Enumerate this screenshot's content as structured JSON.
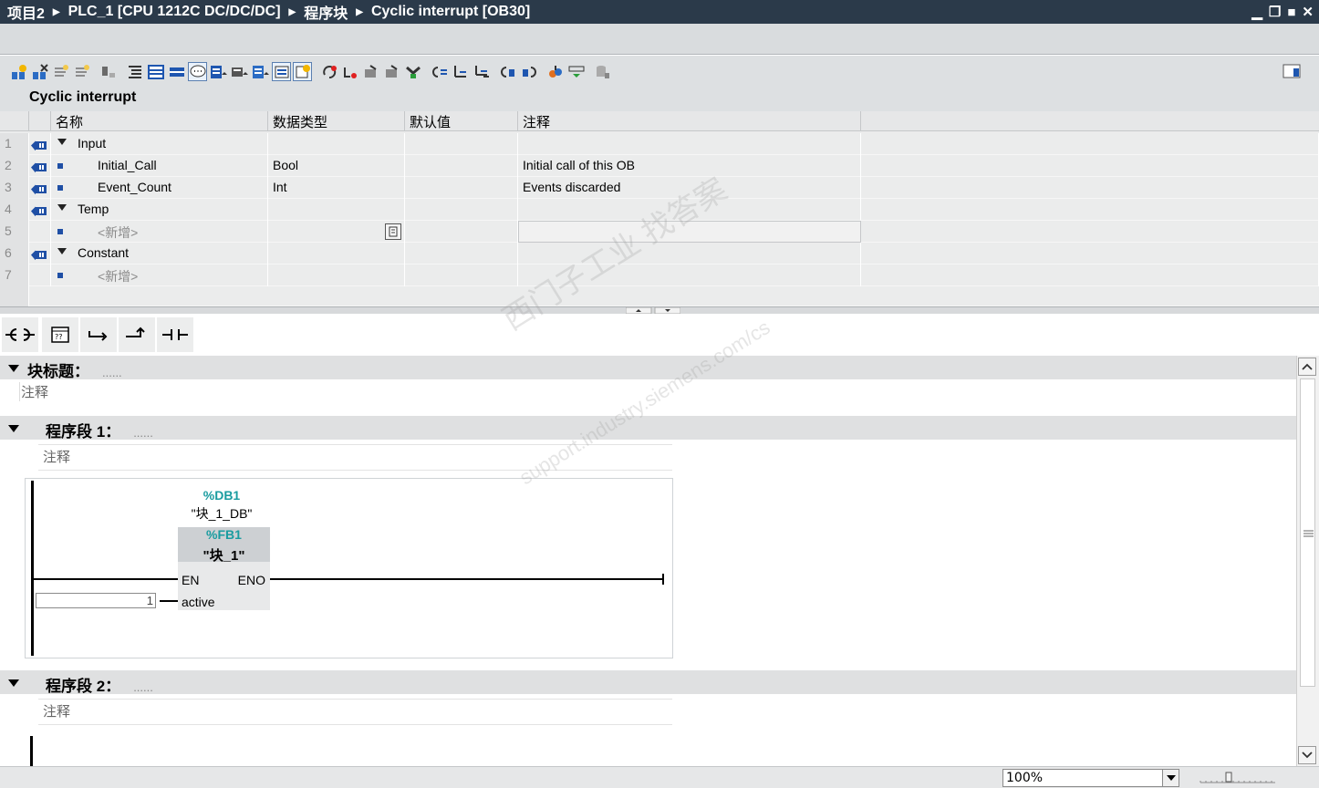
{
  "breadcrumb": [
    "项目2",
    "PLC_1 [CPU 1212C DC/DC/DC]",
    "程序块",
    "Cyclic interrupt [OB30]"
  ],
  "window_controls": {
    "minimize": "▁",
    "restore": "❐",
    "maximize": "■",
    "close": "✕"
  },
  "toolbar": {
    "icons": [
      "insert-network-icon",
      "delete-network-icon",
      "insert-row-icon",
      "insert-row-below-icon",
      "disable-icon",
      "toggle-absolute-icon",
      "expand-icon",
      "collapse-icon",
      "comments-icon",
      "favorites-icon",
      "network-nav-icon",
      "open-all-icon",
      "show-list-icon",
      "instruction-profile-icon",
      "reset-start-icon",
      "reset-icon",
      "go-to-icon",
      "go-to-prev-icon",
      "monitor-icon",
      "download-icon",
      "upload-icon",
      "compare-icon",
      "sync-icon",
      "monitor-on-icon",
      "breakpoint-icon",
      "show-status-icon",
      "sidebar-icon"
    ]
  },
  "section_title": "Cyclic interrupt",
  "interface_table": {
    "columns": [
      "名称",
      "数据类型",
      "默认值",
      "注释"
    ],
    "rows": [
      {
        "num": "1",
        "name": "Input",
        "type": "",
        "default": "",
        "comment": "",
        "kind": "section"
      },
      {
        "num": "2",
        "name": "Initial_Call",
        "type": "Bool",
        "default": "",
        "comment": "Initial call of this OB",
        "kind": "param"
      },
      {
        "num": "3",
        "name": "Event_Count",
        "type": "Int",
        "default": "",
        "comment": "Events discarded",
        "kind": "param"
      },
      {
        "num": "4",
        "name": "Temp",
        "type": "",
        "default": "",
        "comment": "",
        "kind": "section"
      },
      {
        "num": "5",
        "name": "<新增>",
        "type": "",
        "default": "",
        "comment": "",
        "kind": "add"
      },
      {
        "num": "6",
        "name": "Constant",
        "type": "",
        "default": "",
        "comment": "",
        "kind": "section"
      },
      {
        "num": "7",
        "name": "<新增>",
        "type": "",
        "default": "",
        "comment": "",
        "kind": "add"
      }
    ]
  },
  "ladder_toolbar": [
    "normally-open-contact-icon",
    "empty-box-icon",
    "open-branch-icon",
    "close-branch-icon",
    "contact-icon"
  ],
  "block_title": {
    "label": "块标题：",
    "placeholder": "......",
    "comment": "注释"
  },
  "networks": [
    {
      "label": "程序段 1：",
      "placeholder": "......",
      "comment": "注释",
      "fb": {
        "db_address": "%DB1",
        "db_name": "\"块_1_DB\"",
        "fb_address": "%FB1",
        "fb_name": "\"块_1\"",
        "en": "EN",
        "eno": "ENO",
        "input_pin": "active",
        "input_value": "1"
      }
    },
    {
      "label": "程序段 2：",
      "placeholder": "......",
      "comment": "注释"
    }
  ],
  "zoom": {
    "value": "100%"
  },
  "watermark": {
    "line1": "西门子工业  找答案",
    "line2": "support.industry.siemens.com/cs"
  },
  "colors": {
    "titlebar": "#2b3a4a",
    "teal": "#1a9ca0",
    "row_blue": "#1f4fa5"
  }
}
